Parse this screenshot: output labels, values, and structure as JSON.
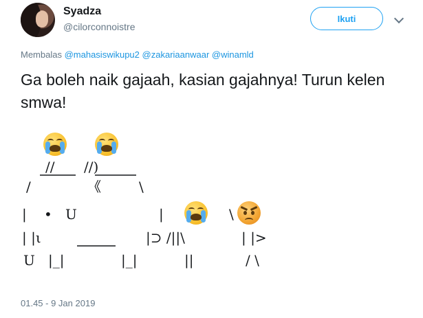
{
  "user": {
    "name": "Syadza",
    "handle": "@cilorconnoistre"
  },
  "follow_button": {
    "label": "Ikuti"
  },
  "reply": {
    "prefix": "Membalas",
    "mentions": [
      "@mahasiswikupu2",
      "@zakariaanwaar",
      "@winamld"
    ]
  },
  "tweet": {
    "text": "Ga boleh naik gajaah, kasian gajahnya! Turun kelen smwa!"
  },
  "ascii_art": {
    "ears": "//",
    "ears_2": "//)",
    "trunk_curl": "《",
    "slash_l": "/",
    "backslash_r": "\\",
    "r1_left": "|",
    "r1_dot": "•",
    "r1_u": "U",
    "r1_bar": "|",
    "r2_left": "| |ι",
    "r2_right": "|⊃ /||\\",
    "r3_u": "U",
    "r3_legs_l": "|_|",
    "r3_legs_r": "|_|",
    "r3_man1": "||",
    "man2_top": "\\",
    "man2_body": "| |>",
    "man2_legs": "/ \\"
  },
  "emoji": [
    "loudly-crying-face",
    "loudly-crying-face",
    "loudly-crying-face",
    "angry-face"
  ],
  "timestamp": "01.45 - 9 Jan 2019"
}
